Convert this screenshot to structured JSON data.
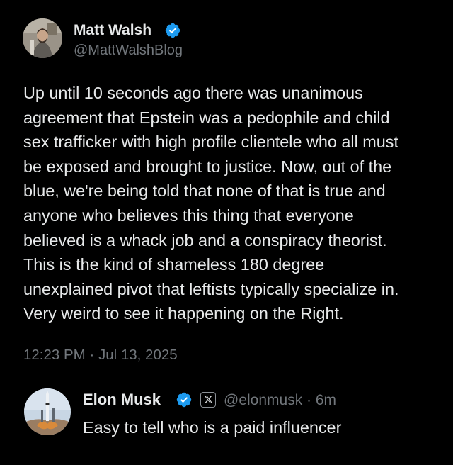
{
  "tweet": {
    "author": {
      "name": "Matt Walsh",
      "handle": "@MattWalshBlog",
      "verified": true
    },
    "body_lines": [
      "Up until 10 seconds ago there was unanimous",
      "agreement that Epstein was a pedophile and child",
      "sex trafficker with high profile clientele who all must",
      "be exposed and brought to justice. Now, out of the",
      "blue, we're being told that none of that is true and",
      "anyone who believes this thing that everyone",
      "believed is a whack job and a conspiracy theorist.",
      "This is the kind of shameless 180 degree",
      "unexplained pivot that leftists typically specialize in.",
      "Very weird to see it happening on the Right."
    ],
    "timestamp": "12:23 PM · Jul 13, 2025"
  },
  "reply": {
    "author": {
      "name": "Elon Musk",
      "handle_meta": "@elonmusk · 6m",
      "verified": true
    },
    "text": "Easy to tell who is a paid influencer"
  },
  "icons": {
    "verified": "verified-badge-icon",
    "affiliation": "x-logo-icon"
  },
  "colors": {
    "background": "#000000",
    "text_primary": "#e7e9ea",
    "text_secondary": "#71767b",
    "verified_blue": "#1d9bf0"
  }
}
